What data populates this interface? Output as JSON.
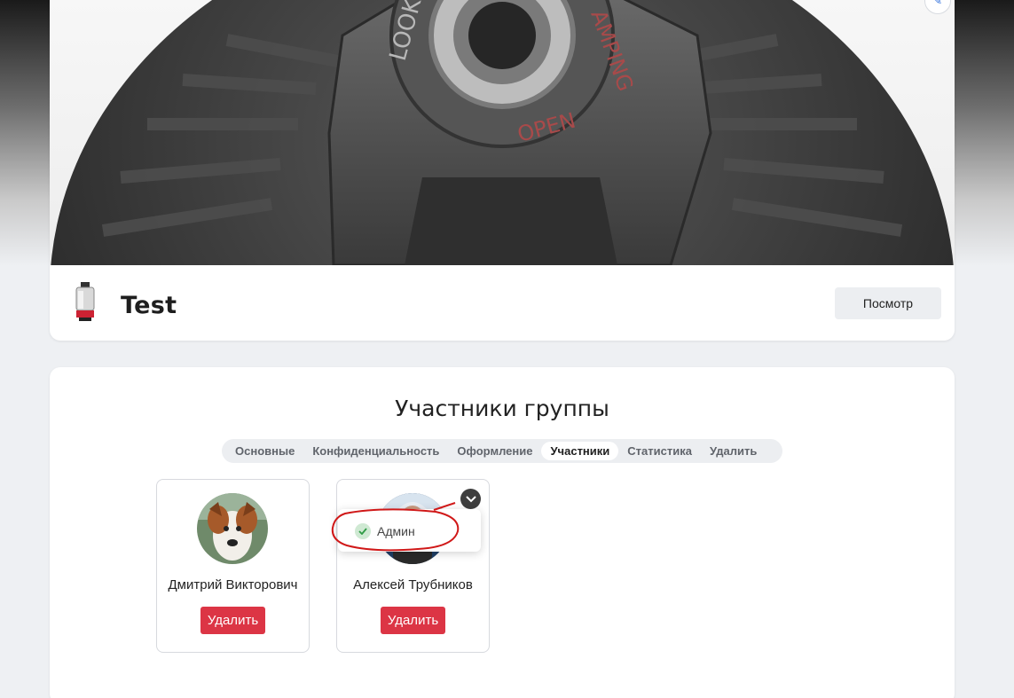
{
  "group": {
    "name": "Test",
    "view_label": "Посмотр"
  },
  "members_section": {
    "title": "Участники группы",
    "tabs": [
      {
        "label": "Основные",
        "active": false
      },
      {
        "label": "Конфиденциальность",
        "active": false
      },
      {
        "label": "Оформление",
        "active": false
      },
      {
        "label": "Участники",
        "active": true
      },
      {
        "label": "Статистика",
        "active": false
      },
      {
        "label": "Удалить",
        "active": false
      }
    ],
    "members": [
      {
        "name": "Дмитрий Викторович",
        "delete_label": "Удалить",
        "avatar": "dog-photo"
      },
      {
        "name": "Алексей Трубников",
        "delete_label": "Удалить",
        "avatar": "person-photo"
      }
    ],
    "role_menu": {
      "items": [
        {
          "label": "Админ",
          "checked": true
        }
      ]
    }
  },
  "colors": {
    "page_bg": "#eef0f3",
    "danger": "#dc3545",
    "accent": "#2f6fdc",
    "tab_bg": "#eceef1"
  },
  "icons": {
    "edit_cover": "pencil-icon",
    "role_toggle": "chevron-down-icon",
    "role_check": "check-icon"
  }
}
